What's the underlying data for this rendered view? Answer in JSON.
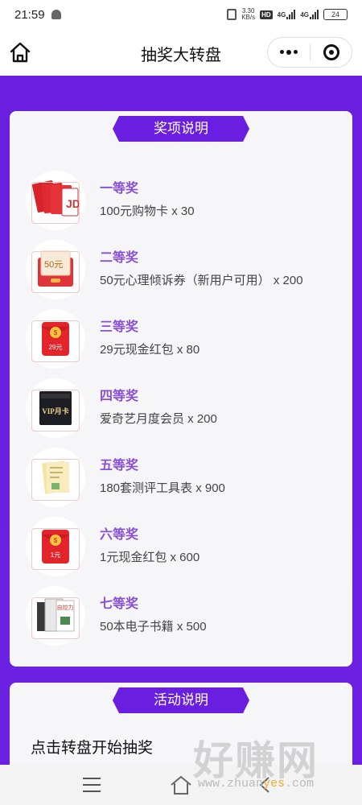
{
  "status_bar": {
    "time": "21:59",
    "speed": "3.30\nKB/s",
    "hd": "HD",
    "net1": "4G",
    "net2": "4G",
    "battery": "24"
  },
  "header": {
    "title": "抽奖大转盘"
  },
  "prizes_card": {
    "title": "奖项说明",
    "items": [
      {
        "name": "一等奖",
        "desc": "100元购物卡 x 30",
        "icon": "shopping-card-icon"
      },
      {
        "name": "二等奖",
        "desc": "50元心理倾诉券（新用户可用） x 200",
        "icon": "coupon-50-icon",
        "icon_label": "50元"
      },
      {
        "name": "三等奖",
        "desc": "29元现金红包 x 80",
        "icon": "red-envelope-icon",
        "icon_label": "29元"
      },
      {
        "name": "四等奖",
        "desc": "爱奇艺月度会员 x 200",
        "icon": "vip-card-icon",
        "icon_label": "VIP月卡"
      },
      {
        "name": "五等奖",
        "desc": "180套测评工具表 x 900",
        "icon": "folder-icon"
      },
      {
        "name": "六等奖",
        "desc": "1元现金红包 x 600",
        "icon": "red-envelope-icon",
        "icon_label": "1元"
      },
      {
        "name": "七等奖",
        "desc": "50本电子书籍 x 500",
        "icon": "books-icon",
        "icon_label": "自控力"
      }
    ]
  },
  "activity_card": {
    "title": "活动说明",
    "text": "点击转盘开始抽奖"
  },
  "watermark": {
    "big": "好赚网",
    "url_a": "www.zhuan",
    "url_b": "yes",
    "url_c": ".com"
  },
  "colors": {
    "accent": "#6a1fe0",
    "prize_name": "#8a4fd8",
    "card_bg": "#f6f6f8"
  }
}
